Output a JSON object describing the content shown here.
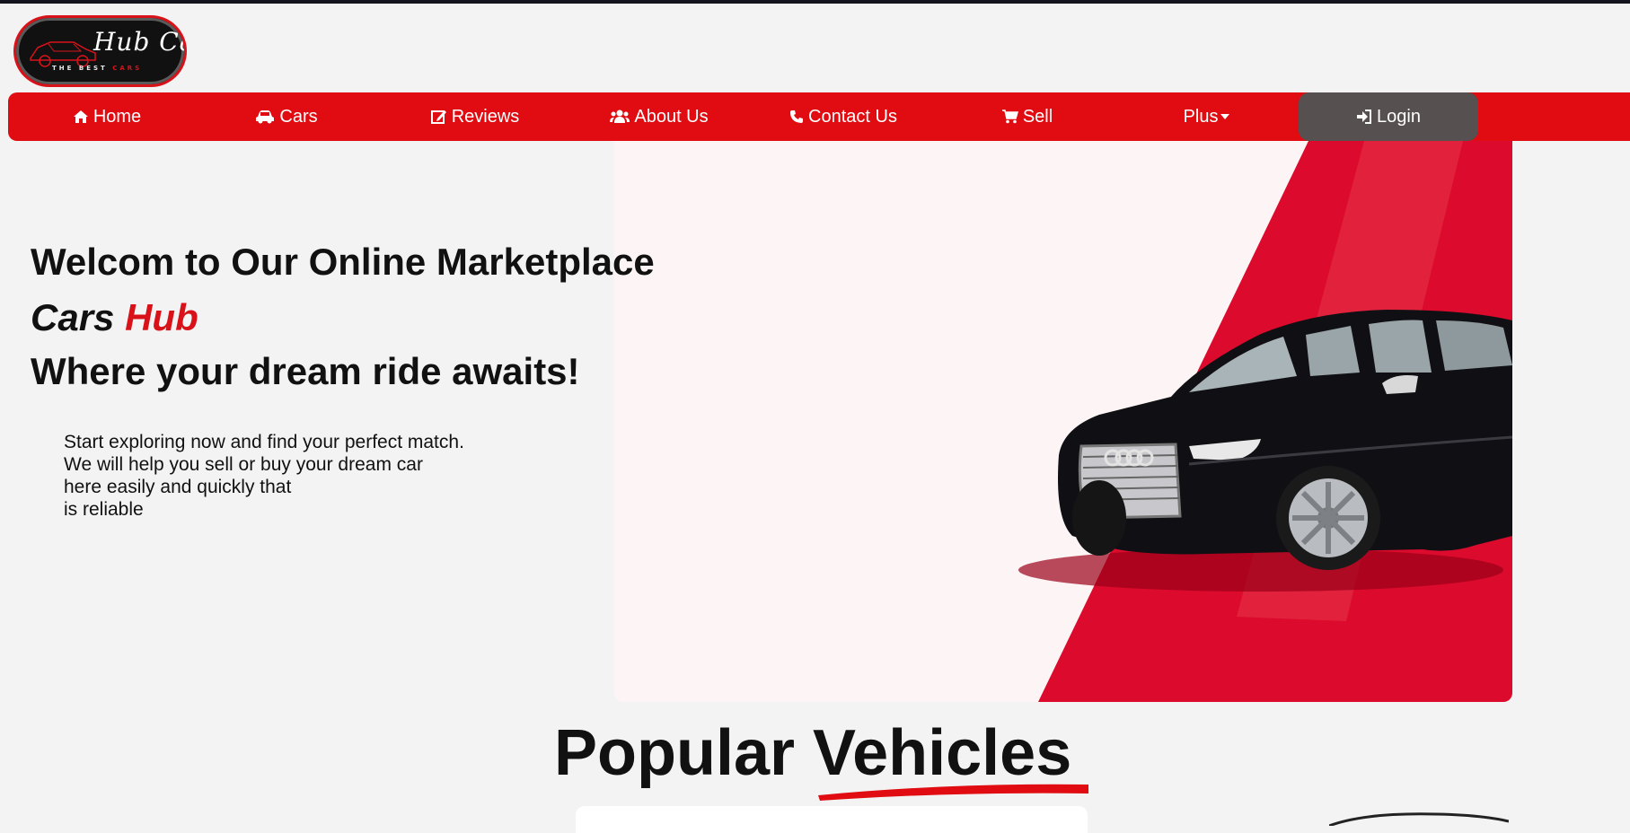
{
  "logo": {
    "script_text": "Hub Car",
    "tagline_left": "THE BEST ",
    "tagline_right": "CARS"
  },
  "nav": {
    "items": [
      {
        "label": "Home",
        "icon": "home-icon"
      },
      {
        "label": "Cars",
        "icon": "car-icon"
      },
      {
        "label": "Reviews",
        "icon": "edit-icon"
      },
      {
        "label": "About Us",
        "icon": "users-icon"
      },
      {
        "label": "Contact Us",
        "icon": "phone-icon"
      },
      {
        "label": "Sell",
        "icon": "cart-icon"
      },
      {
        "label": "Plus",
        "icon": "caret-down-icon"
      },
      {
        "label": "Login",
        "icon": "sign-in-icon"
      }
    ]
  },
  "hero": {
    "title_line1": "Welcom to Our Online Marketplace",
    "title_brand_part1": "Cars",
    "title_brand_part2": "Hub",
    "title_line3": "Where your dream ride awaits!",
    "desc_lines": [
      "Start exploring now and find your perfect match.",
      "We will help you sell or buy your dream car",
      "here easily and quickly that",
      "is reliable"
    ]
  },
  "popular": {
    "word1": "Popular",
    "word2": "Vehicles"
  },
  "colors": {
    "brand_red": "#e00c11",
    "login_bg": "#575050",
    "page_bg": "#f3f3f3"
  }
}
